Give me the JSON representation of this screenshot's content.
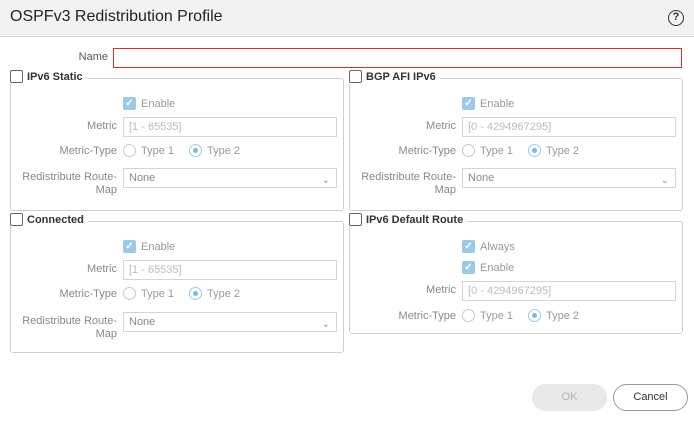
{
  "dialog": {
    "title": "OSPFv3 Redistribution Profile",
    "help_symbol": "?"
  },
  "name": {
    "label": "Name",
    "value": ""
  },
  "ipv6_static": {
    "legend": "IPv6 Static",
    "checked": false,
    "enable_label": "Enable",
    "enable_checked": true,
    "metric_label": "Metric",
    "metric_placeholder": "[1 - 65535]",
    "metric_type_label": "Metric-Type",
    "type1_label": "Type 1",
    "type2_label": "Type 2",
    "metric_type_selected": "Type 2",
    "route_map_label_1": "Redistribute Route-",
    "route_map_label_2": "Map",
    "route_map_value": "None"
  },
  "bgp_afi_ipv6": {
    "legend": "BGP AFI IPv6",
    "checked": false,
    "enable_label": "Enable",
    "enable_checked": true,
    "metric_label": "Metric",
    "metric_placeholder": "[0 - 4294967295]",
    "metric_type_label": "Metric-Type",
    "type1_label": "Type 1",
    "type2_label": "Type 2",
    "metric_type_selected": "Type 2",
    "route_map_label_1": "Redistribute Route-",
    "route_map_label_2": "Map",
    "route_map_value": "None"
  },
  "connected": {
    "legend": "Connected",
    "checked": false,
    "enable_label": "Enable",
    "enable_checked": true,
    "metric_label": "Metric",
    "metric_placeholder": "[1 - 65535]",
    "metric_type_label": "Metric-Type",
    "type1_label": "Type 1",
    "type2_label": "Type 2",
    "metric_type_selected": "Type 2",
    "route_map_label_1": "Redistribute Route-",
    "route_map_label_2": "Map",
    "route_map_value": "None"
  },
  "ipv6_default_route": {
    "legend": "IPv6 Default Route",
    "checked": false,
    "always_label": "Always",
    "always_checked": true,
    "enable_label": "Enable",
    "enable_checked": true,
    "metric_label": "Metric",
    "metric_placeholder": "[0 - 4294967295]",
    "metric_type_label": "Metric-Type",
    "type1_label": "Type 1",
    "type2_label": "Type 2",
    "metric_type_selected": "Type 2"
  },
  "footer": {
    "ok_label": "OK",
    "cancel_label": "Cancel"
  },
  "colors": {
    "error_border": "#c0392b",
    "checked_fill": "#9dc9e6"
  }
}
